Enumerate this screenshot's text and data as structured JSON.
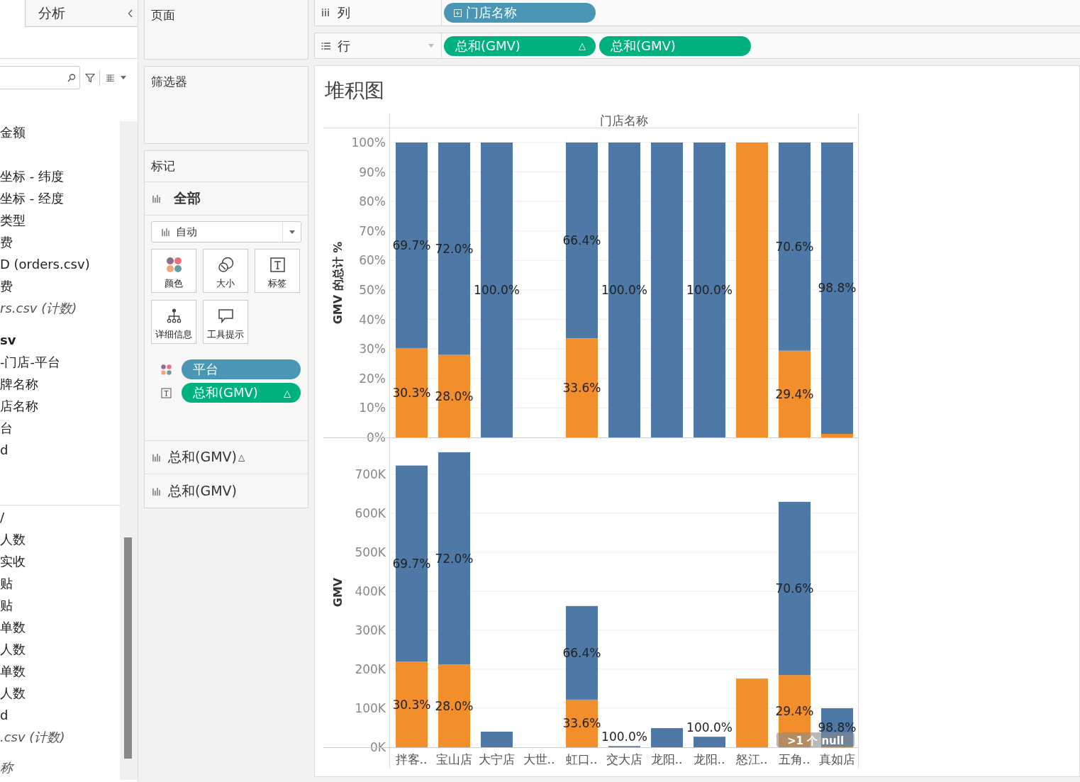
{
  "data_pane": {
    "tab": "分析",
    "sections": [
      {
        "items": [
          {
            "text": "金额",
            "kind": "normal"
          }
        ]
      },
      {
        "items": [
          {
            "text": "坐标 - 纬度",
            "kind": "normal"
          },
          {
            "text": "坐标 - 经度",
            "kind": "normal"
          },
          {
            "text": "类型",
            "kind": "normal"
          },
          {
            "text": "费",
            "kind": "normal"
          },
          {
            "text": "D (orders.csv)",
            "kind": "normal"
          },
          {
            "text": "费",
            "kind": "normal"
          },
          {
            "text": "rs.csv (计数)",
            "kind": "italic"
          }
        ]
      },
      {
        "items": [
          {
            "text": "sv",
            "kind": "bold"
          },
          {
            "text": "-门店-平台",
            "kind": "normal"
          },
          {
            "text": "牌名称",
            "kind": "normal"
          },
          {
            "text": "店名称",
            "kind": "normal"
          },
          {
            "text": "台",
            "kind": "normal"
          },
          {
            "text": "d",
            "kind": "normal"
          }
        ]
      },
      {
        "items": [
          {
            "text": "/",
            "kind": "normal"
          },
          {
            "text": "人数",
            "kind": "normal"
          },
          {
            "text": "实收",
            "kind": "normal"
          },
          {
            "text": "贴",
            "kind": "normal"
          },
          {
            "text": "贴",
            "kind": "normal"
          },
          {
            "text": "单数",
            "kind": "normal"
          },
          {
            "text": "人数",
            "kind": "normal"
          },
          {
            "text": "单数",
            "kind": "normal"
          },
          {
            "text": "人数",
            "kind": "normal"
          },
          {
            "text": "d",
            "kind": "normal"
          },
          {
            "text": ".csv (计数)",
            "kind": "italic"
          }
        ]
      },
      {
        "items": [
          {
            "text": "称",
            "kind": "italic"
          }
        ]
      }
    ]
  },
  "pages": {
    "title": "页面"
  },
  "filters": {
    "title": "筛选器"
  },
  "marks": {
    "title": "标记",
    "all": "全部",
    "mark_type": "自动",
    "cards": [
      {
        "label": "颜色",
        "kind": "color"
      },
      {
        "label": "大小",
        "kind": "size"
      },
      {
        "label": "标签",
        "kind": "label"
      },
      {
        "label": "详细信息",
        "kind": "detail"
      },
      {
        "label": "工具提示",
        "kind": "tooltip"
      }
    ],
    "pills": [
      {
        "kind": "color",
        "label": "平台",
        "color": "#4a96b4"
      },
      {
        "kind": "label",
        "label": "总和(GMV)",
        "color": "#00b180",
        "delta": "△"
      }
    ],
    "layers": [
      {
        "label": "总和(GMV)",
        "delta": "△"
      },
      {
        "label": "总和(GMV)"
      }
    ]
  },
  "columns_shelf": {
    "label": "列",
    "pills": [
      {
        "label": "门店名称",
        "kind": "dimension"
      }
    ]
  },
  "rows_shelf": {
    "label": "行",
    "pills": [
      {
        "label": "总和(GMV)",
        "kind": "measure",
        "delta": "△"
      },
      {
        "label": "总和(GMV)",
        "kind": "measure"
      }
    ]
  },
  "view": {
    "title": "堆积图",
    "null_badge": ">1 个 null",
    "charts": [
      {
        "chart_data": {
          "type": "bar",
          "stacked": true,
          "grid": true,
          "xlabel": "门店名称",
          "ylabel": "GMV 的总计 %",
          "ylim": [
            0,
            104.8
          ],
          "yticks": [
            {
              "value": 0,
              "label": "0%"
            },
            {
              "value": 10,
              "label": "10%"
            },
            {
              "value": 20,
              "label": "20%"
            },
            {
              "value": 30,
              "label": "30%"
            },
            {
              "value": 40,
              "label": "40%"
            },
            {
              "value": 50,
              "label": "50%"
            },
            {
              "value": 60,
              "label": "60%"
            },
            {
              "value": 70,
              "label": "70%"
            },
            {
              "value": 80,
              "label": "80%"
            },
            {
              "value": 90,
              "label": "90%"
            },
            {
              "value": 100,
              "label": "100%"
            }
          ],
          "series": [
            {
              "color": "#f28e2b",
              "values": [
                30.3,
                28.0,
                0,
                null,
                33.6,
                0,
                0,
                0,
                100,
                29.4,
                1.2
              ]
            },
            {
              "color": "#4e79a7",
              "values": [
                69.7,
                72.0,
                100,
                null,
                66.4,
                100,
                100,
                100,
                0,
                70.6,
                98.8
              ]
            }
          ],
          "value_labels": [
            [
              "30.3%",
              "28.0%",
              null,
              null,
              "33.6%",
              null,
              null,
              null,
              null,
              "29.4%",
              null
            ],
            [
              "69.7%",
              "72.0%",
              "100.0%",
              null,
              "66.4%",
              "100.0%",
              null,
              "100.0%",
              null,
              "70.6%",
              "98.8%"
            ]
          ]
        }
      },
      {
        "chart_data": {
          "type": "bar",
          "stacked": true,
          "grid": true,
          "ylabel": "GMV",
          "ylim": [
            0,
            794000
          ],
          "categories": [
            "拌客..",
            "宝山店",
            "大宁店",
            "大世..",
            "虹口..",
            "交大店",
            "龙阳..",
            "龙阳..",
            "怒江..",
            "五角..",
            "真如店"
          ],
          "yticks": [
            {
              "value": 0,
              "label": "0K"
            },
            {
              "value": 100000,
              "label": "100K"
            },
            {
              "value": 200000,
              "label": "200K"
            },
            {
              "value": 300000,
              "label": "300K"
            },
            {
              "value": 400000,
              "label": "400K"
            },
            {
              "value": 500000,
              "label": "500K"
            },
            {
              "value": 600000,
              "label": "600K"
            },
            {
              "value": 700000,
              "label": "700K"
            }
          ],
          "series": [
            {
              "color": "#f28e2b",
              "values": [
                219000,
                212000,
                0,
                null,
                122000,
                0,
                0,
                0,
                176000,
                185000,
                1000
              ]
            },
            {
              "color": "#4e79a7",
              "values": [
                503000,
                544000,
                40000,
                null,
                240000,
                3000,
                49000,
                27000,
                0,
                444000,
                99000
              ]
            }
          ],
          "value_labels": [
            [
              "30.3%",
              "28.0%",
              null,
              null,
              "33.6%",
              null,
              null,
              null,
              null,
              "29.4%",
              null
            ],
            [
              "69.7%",
              "72.0%",
              null,
              null,
              "66.4%",
              "100.0%",
              null,
              "100.0%",
              null,
              "70.6%",
              "98.8%"
            ]
          ]
        }
      }
    ]
  }
}
